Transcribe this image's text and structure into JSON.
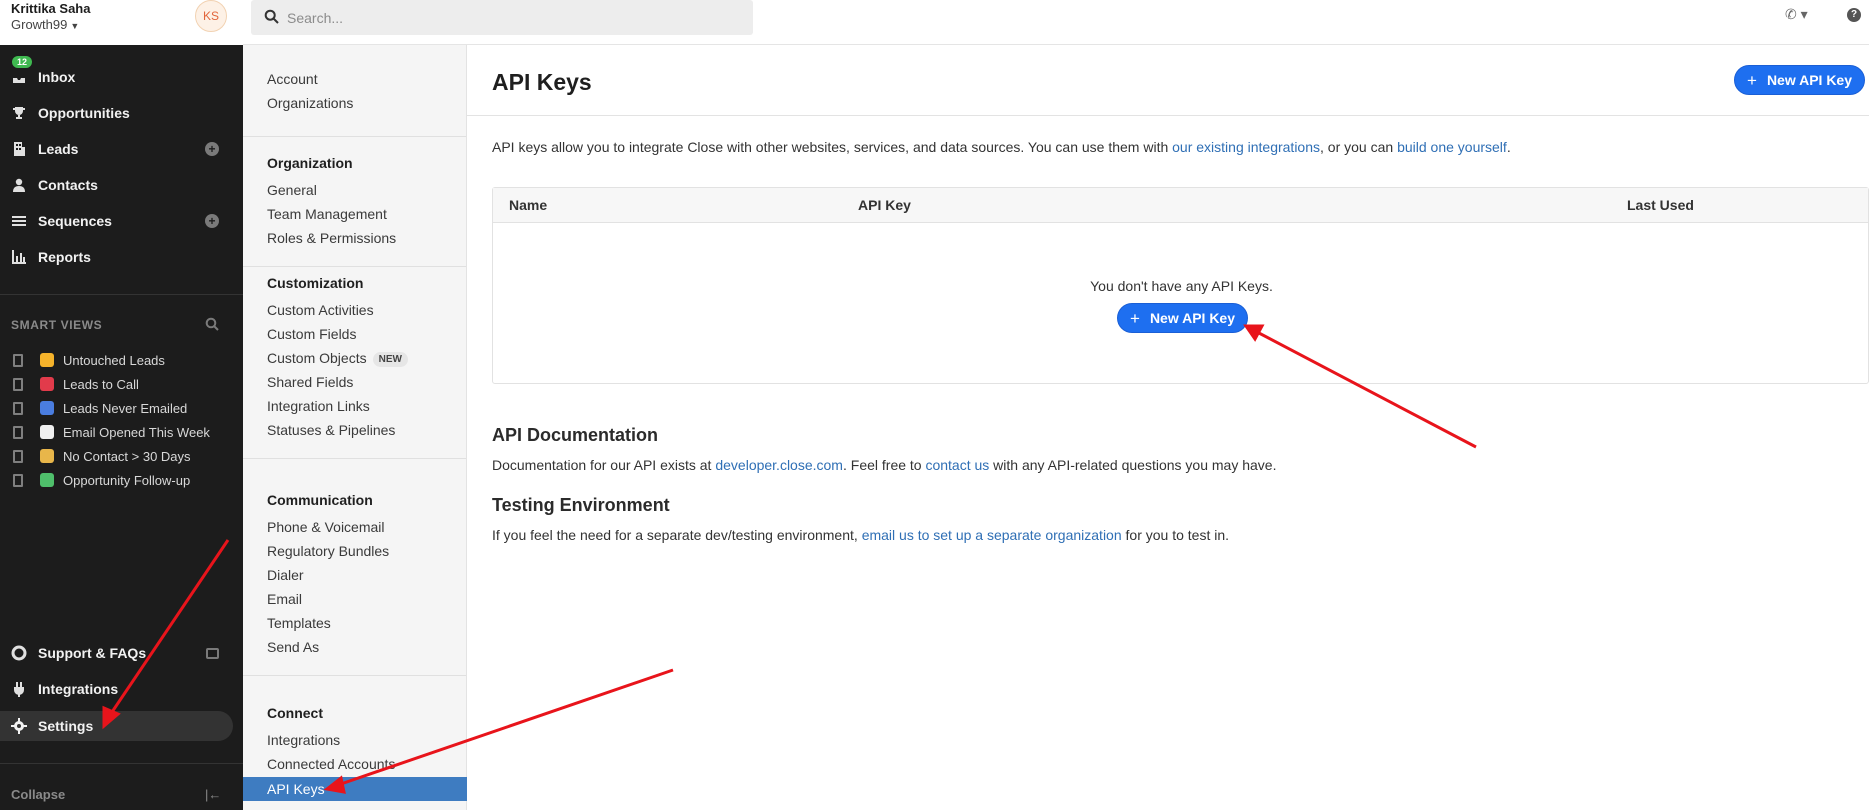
{
  "user": {
    "name": "Krittika Saha",
    "org": "Growth99",
    "initials": "KS"
  },
  "nav": {
    "inbox": {
      "label": "Inbox",
      "badge": "12"
    },
    "opportunities": "Opportunities",
    "leads": "Leads",
    "contacts": "Contacts",
    "sequences": "Sequences",
    "reports": "Reports"
  },
  "smart_views": {
    "heading": "SMART VIEWS",
    "items": [
      {
        "label": "Untouched Leads",
        "icon": "bell-icon",
        "color": "#f5b32b"
      },
      {
        "label": "Leads to Call",
        "icon": "telephone-icon",
        "color": "#e23b4b"
      },
      {
        "label": "Leads Never Emailed",
        "icon": "mailbox-icon",
        "color": "#4a7de0"
      },
      {
        "label": "Email Opened This Week",
        "icon": "eyes-icon",
        "color": "#f0f0f0"
      },
      {
        "label": "No Contact > 30 Days",
        "icon": "hourglass-icon",
        "color": "#e8b64a"
      },
      {
        "label": "Opportunity Follow-up",
        "icon": "money-wings-icon",
        "color": "#4fbf6b"
      }
    ]
  },
  "bottom_nav": {
    "support": "Support & FAQs",
    "integrations": "Integrations",
    "settings": "Settings",
    "collapse": "Collapse"
  },
  "search": {
    "placeholder": "Search..."
  },
  "settings_nav": {
    "top_links": [
      "Account",
      "Organizations"
    ],
    "organization": {
      "title": "Organization",
      "links": [
        "General",
        "Team Management",
        "Roles & Permissions"
      ]
    },
    "customization": {
      "title": "Customization",
      "links": [
        "Custom Activities",
        "Custom Fields",
        "Custom Objects",
        "Shared Fields",
        "Integration Links",
        "Statuses & Pipelines"
      ],
      "new_badge": "NEW"
    },
    "communication": {
      "title": "Communication",
      "links": [
        "Phone & Voicemail",
        "Regulatory Bundles",
        "Dialer",
        "Email",
        "Templates",
        "Send As"
      ]
    },
    "connect": {
      "title": "Connect",
      "links": [
        "Integrations",
        "Connected Accounts",
        "API Keys"
      ]
    }
  },
  "main": {
    "title": "API Keys",
    "new_button": "New API Key",
    "intro": {
      "text1": "API keys allow you to integrate Close with other websites, services, and data sources. You can use them with ",
      "link1": "our existing integrations",
      "text2": ", or you can ",
      "link2": "build one yourself",
      "text3": "."
    },
    "table": {
      "columns": [
        "Name",
        "API Key",
        "Last Used"
      ],
      "empty": "You don't have any API Keys.",
      "button": "New API Key"
    },
    "docs": {
      "heading": "API Documentation",
      "text1": "Documentation for our API exists at ",
      "link1": "developer.close.com",
      "text2": ". Feel free to ",
      "link2": "contact us",
      "text3": " with any API-related questions you may have."
    },
    "testing": {
      "heading": "Testing Environment",
      "text1": "If you feel the need for a separate dev/testing environment, ",
      "link1": "email us to set up a separate organization",
      "text2": " for you to test in."
    }
  },
  "colors": {
    "accent": "#1e6ff0",
    "link": "#2f6fb5",
    "active_nav": "#3e7cc1",
    "sidebar": "#1c1c1c",
    "annotation": "#e8141b"
  }
}
